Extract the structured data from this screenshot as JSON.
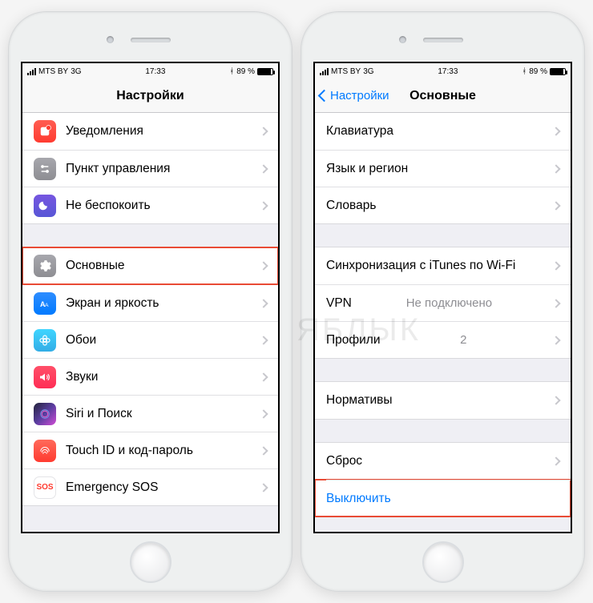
{
  "status": {
    "carrier": "MTS BY",
    "network": "3G",
    "time": "17:33",
    "battery_pct": "89 %",
    "bt": "✱"
  },
  "watermark": "ЯБЛЫК",
  "left": {
    "title": "Настройки",
    "g1": [
      {
        "label": "Уведомления",
        "icon": "notifications-icon"
      },
      {
        "label": "Пункт управления",
        "icon": "control-center-icon"
      },
      {
        "label": "Не беспокоить",
        "icon": "dnd-icon"
      }
    ],
    "g2": [
      {
        "label": "Основные",
        "icon": "general-icon"
      },
      {
        "label": "Экран и яркость",
        "icon": "display-icon"
      },
      {
        "label": "Обои",
        "icon": "wallpaper-icon"
      },
      {
        "label": "Звуки",
        "icon": "sounds-icon"
      },
      {
        "label": "Siri и Поиск",
        "icon": "siri-icon"
      },
      {
        "label": "Touch ID и код-пароль",
        "icon": "touchid-icon"
      },
      {
        "label": "Emergency SOS",
        "icon": "sos-icon"
      }
    ]
  },
  "right": {
    "back": "Настройки",
    "title": "Основные",
    "g1": [
      {
        "label": "Клавиатура"
      },
      {
        "label": "Язык и регион"
      },
      {
        "label": "Словарь"
      }
    ],
    "g2": [
      {
        "label": "Синхронизация с iTunes по Wi-Fi"
      },
      {
        "label": "VPN",
        "value": "Не подключено"
      },
      {
        "label": "Профили",
        "value": "2"
      }
    ],
    "g3": [
      {
        "label": "Нормативы"
      }
    ],
    "g4": [
      {
        "label": "Сброс"
      },
      {
        "label": "Выключить"
      }
    ]
  }
}
